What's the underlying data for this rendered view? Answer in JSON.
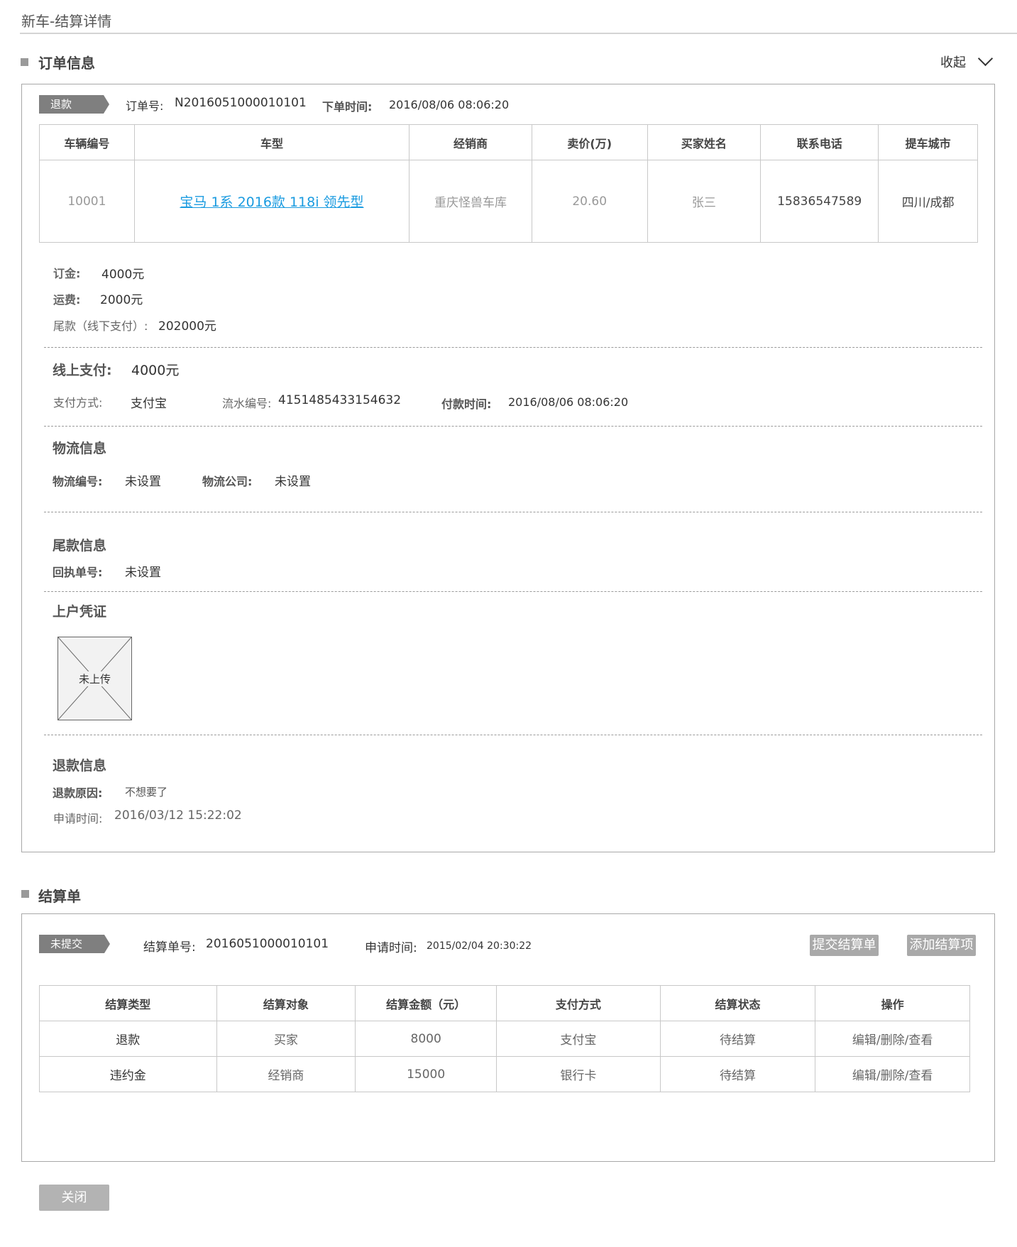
{
  "page": {
    "title": "新车-结算详情"
  },
  "order_section": {
    "heading": "订单信息",
    "collapse_label": "收起",
    "status_tag": "退款",
    "order_no_label": "订单号:",
    "order_no": "N2016051000010101",
    "order_time_label": "下单时间:",
    "order_time": "2016/08/06  08:06:20",
    "table": {
      "headers": [
        "车辆编号",
        "车型",
        "经销商",
        "卖价(万)",
        "买家姓名",
        "联系电话",
        "提车城市"
      ],
      "row": {
        "vehicle_no": "10001",
        "model": "宝马 1系  2016款 118i 领先型",
        "dealer": "重庆怪兽车库",
        "price": "20.60",
        "buyer": "张三",
        "phone": "15836547589",
        "city": "四川/成都"
      }
    },
    "fees": {
      "deposit_label": "订金:",
      "deposit": "4000元",
      "freight_label": "运费:",
      "freight": "2000元",
      "balance_label": "尾款（线下支付）:",
      "balance": "202000元"
    },
    "online_pay": {
      "label": "线上支付:",
      "amount": "4000元",
      "method_label": "支付方式:",
      "method": "支付宝",
      "serial_label": "流水编号:",
      "serial": "4151485433154632",
      "time_label": "付款时间:",
      "time": "2016/08/06  08:06:20"
    },
    "logistics": {
      "heading": "物流信息",
      "no_label": "物流编号:",
      "no": "未设置",
      "company_label": "物流公司:",
      "company": "未设置"
    },
    "balance_info": {
      "heading": "尾款信息",
      "receipt_label": "回执单号:",
      "receipt": "未设置"
    },
    "registration": {
      "heading": "上户凭证",
      "image_text": "未上传"
    },
    "refund": {
      "heading": "退款信息",
      "reason_label": "退款原因:",
      "reason": "不想要了",
      "apply_time_label": "申请时间:",
      "apply_time": "2016/03/12    15:22:02"
    }
  },
  "settlement_section": {
    "heading": "结算单",
    "status_tag": "未提交",
    "no_label": "结算单号:",
    "no": "2016051000010101",
    "apply_time_label": "申请时间:",
    "apply_time": "2015/02/04 20:30:22",
    "submit_button": "提交结算单",
    "add_button": "添加结算项",
    "table": {
      "headers": [
        "结算类型",
        "结算对象",
        "结算金额（元）",
        "支付方式",
        "结算状态",
        "操作"
      ],
      "rows": [
        {
          "type": "退款",
          "target": "买家",
          "amount": "8000",
          "method": "支付宝",
          "status": "待结算",
          "action": "编辑/删除/查看"
        },
        {
          "type": "违约金",
          "target": "经销商",
          "amount": "15000",
          "method": "银行卡",
          "status": "待结算",
          "action": "编辑/删除/查看"
        }
      ]
    }
  },
  "close_button": "关闭"
}
